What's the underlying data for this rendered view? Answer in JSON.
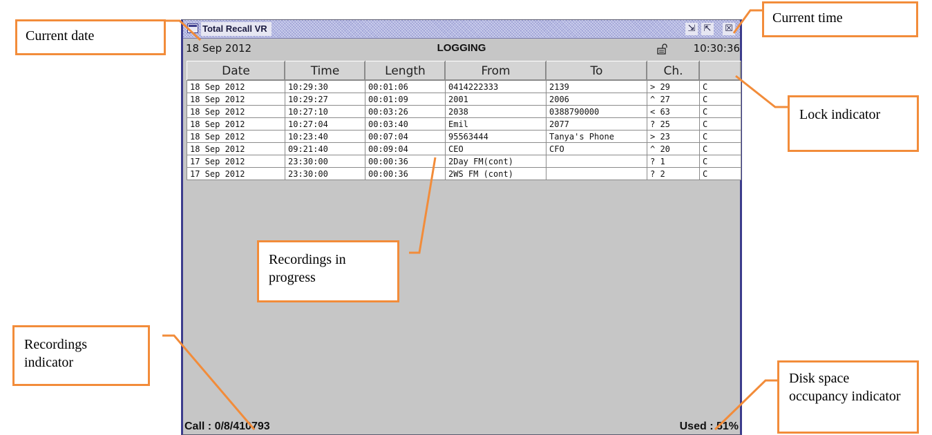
{
  "window": {
    "title": "Total Recall VR",
    "controls": {
      "minimize": "⇲",
      "maximize": "⇱",
      "close": "☒"
    }
  },
  "status": {
    "current_date": "18 Sep 2012",
    "mode": "LOGGING",
    "current_time": "10:30:36"
  },
  "table": {
    "columns": [
      "Date",
      "Time",
      "Length",
      "From",
      "To",
      "Ch.",
      ""
    ],
    "rows": [
      [
        "18 Sep 2012",
        "10:29:30",
        "00:01:06",
        "0414222333",
        "2139",
        "> 29",
        "C"
      ],
      [
        "18 Sep 2012",
        "10:29:27",
        "00:01:09",
        "2001",
        "2006",
        "^ 27",
        "C"
      ],
      [
        "18 Sep 2012",
        "10:27:10",
        "00:03:26",
        "2038",
        "0388790000",
        "< 63",
        "C"
      ],
      [
        "18 Sep 2012",
        "10:27:04",
        "00:03:40",
        "Emil",
        "2077",
        "? 25",
        "C"
      ],
      [
        "18 Sep 2012",
        "10:23:40",
        "00:07:04",
        "95563444",
        "Tanya's Phone",
        "> 23",
        "C"
      ],
      [
        "18 Sep 2012",
        "09:21:40",
        "00:09:04",
        "CEO",
        "CFO",
        "^ 20",
        "C"
      ],
      [
        "17 Sep 2012",
        "23:30:00",
        "00:00:36",
        "2Day FM(cont)",
        "",
        "? 1",
        "C"
      ],
      [
        "17 Sep 2012",
        "23:30:00",
        "00:00:36",
        "2WS FM (cont)",
        "",
        "? 2",
        "C"
      ]
    ]
  },
  "footer": {
    "calls": "Call : 0/8/410793",
    "disk_used": "Used : 51%"
  },
  "callouts": {
    "current_date": "Current date",
    "current_time": "Current time",
    "lock_indicator": "Lock indicator",
    "recordings_in_progress": "Recordings in progress",
    "recordings_indicator": "Recordings indicator",
    "disk_space": "Disk space occupancy indicator"
  },
  "colors": {
    "callout_border": "#f28c3a",
    "window_frame": "#3c3c8c",
    "window_bg": "#c6c6c6"
  }
}
